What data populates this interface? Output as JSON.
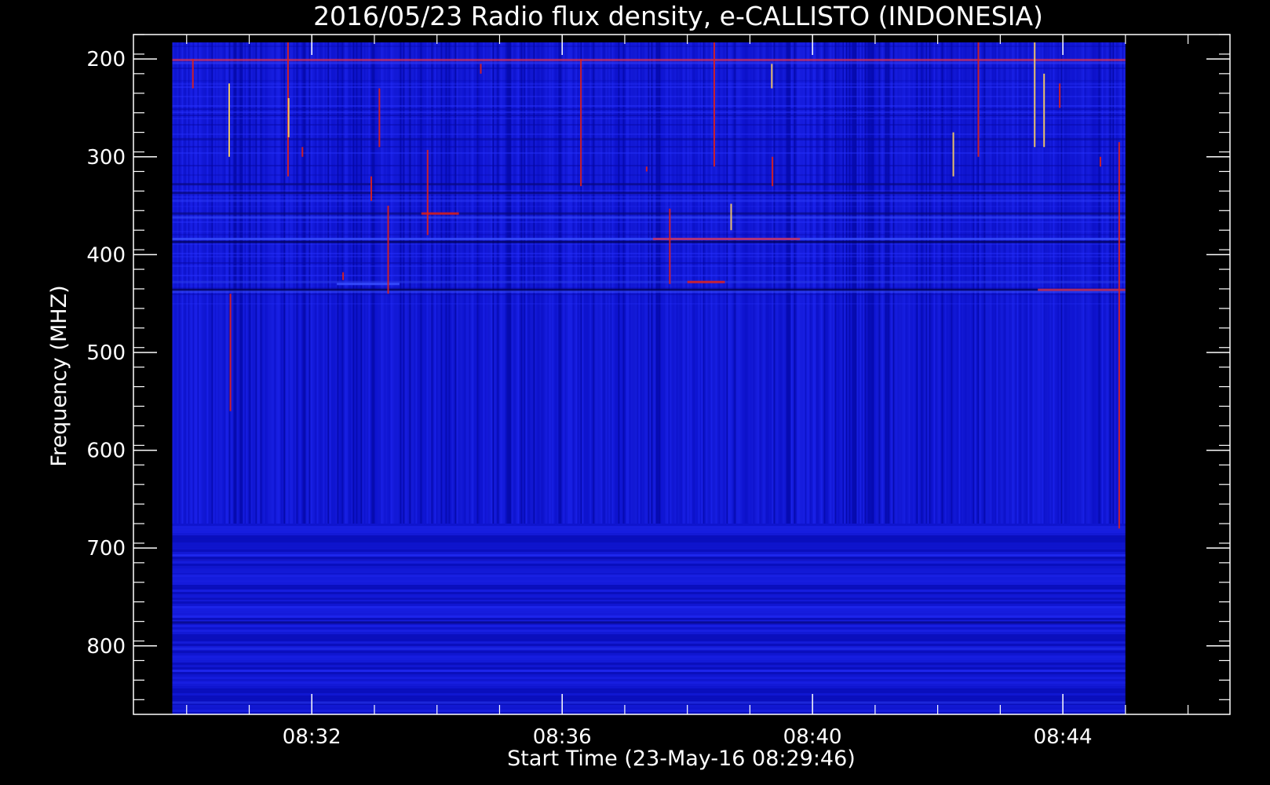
{
  "chart_data": {
    "type": "heatmap",
    "title": "2016/05/23  Radio flux density, e-CALLISTO (INDONESIA)",
    "xlabel": "Start Time (23-May-16 08:29:46)",
    "ylabel": "Frequency (MHZ)",
    "x_start_minutes": 509.77,
    "x_end_minutes": 525.0,
    "xlim_minutes": [
      509.15,
      526.67
    ],
    "x_ticks": [
      {
        "label": "08:32",
        "value": 512
      },
      {
        "label": "08:36",
        "value": 516
      },
      {
        "label": "08:40",
        "value": 520
      },
      {
        "label": "08:44",
        "value": 524
      }
    ],
    "ylim": [
      870,
      175
    ],
    "y_extent": [
      183,
      870
    ],
    "y_ticks": [
      200,
      300,
      400,
      500,
      600,
      700,
      800
    ],
    "colors": {
      "background": "#000000",
      "axis": "#ffffff",
      "low": "#0a0fc0",
      "mid": "#1d25ee",
      "high": "#e0201a",
      "peak": "#ffd060"
    },
    "horizontal_bands": [
      {
        "freq": 201,
        "color": "#d8305a",
        "opacity": 0.7
      },
      {
        "freq": 204,
        "color": "#3a44ff",
        "opacity": 0.5
      },
      {
        "freq": 282,
        "color": "#050590",
        "opacity": 0.5
      },
      {
        "freq": 328,
        "color": "#08087a",
        "opacity": 0.6
      },
      {
        "freq": 337,
        "color": "#060670",
        "opacity": 0.7
      },
      {
        "freq": 345,
        "color": "#3040ff",
        "opacity": 0.45
      },
      {
        "freq": 358,
        "color": "#060670",
        "opacity": 0.6
      },
      {
        "freq": 362,
        "color": "#3a50ff",
        "opacity": 0.55
      },
      {
        "freq": 384,
        "color": "#3a50ff",
        "opacity": 0.8
      },
      {
        "freq": 387,
        "color": "#040460",
        "opacity": 0.8
      },
      {
        "freq": 428,
        "color": "#3a50ff",
        "opacity": 0.4
      },
      {
        "freq": 436,
        "color": "#04045a",
        "opacity": 0.8
      },
      {
        "freq": 438,
        "color": "#3a50ff",
        "opacity": 0.5
      },
      {
        "freq": 712,
        "color": "#05059a",
        "opacity": 0.4
      },
      {
        "freq": 728,
        "color": "#2a35ff",
        "opacity": 0.3
      },
      {
        "freq": 752,
        "color": "#05059a",
        "opacity": 0.4
      },
      {
        "freq": 776,
        "color": "#04046a",
        "opacity": 0.6
      },
      {
        "freq": 803,
        "color": "#3040ff",
        "opacity": 0.35
      },
      {
        "freq": 858,
        "color": "#3545ff",
        "opacity": 0.45
      }
    ],
    "bursts": [
      {
        "time": 510.1,
        "f1": 200,
        "f2": 230,
        "color": "#e0201a"
      },
      {
        "time": 510.68,
        "f1": 225,
        "f2": 300,
        "color": "#ffd060"
      },
      {
        "time": 510.7,
        "f1": 440,
        "f2": 560,
        "color": "#e0201a"
      },
      {
        "time": 511.62,
        "f1": 183,
        "f2": 320,
        "color": "#e0201a"
      },
      {
        "time": 511.63,
        "f1": 240,
        "f2": 280,
        "color": "#ffd060"
      },
      {
        "time": 511.85,
        "f1": 290,
        "f2": 300,
        "color": "#e0201a"
      },
      {
        "time": 512.5,
        "f1": 418,
        "f2": 426,
        "color": "#e0201a"
      },
      {
        "time": 512.95,
        "f1": 320,
        "f2": 345,
        "color": "#e0201a"
      },
      {
        "time": 513.08,
        "f1": 230,
        "f2": 290,
        "color": "#e0201a"
      },
      {
        "time": 513.22,
        "f1": 350,
        "f2": 440,
        "color": "#e0201a"
      },
      {
        "time": 513.85,
        "f1": 293,
        "f2": 380,
        "color": "#e0201a"
      },
      {
        "time": 514.7,
        "f1": 205,
        "f2": 215,
        "color": "#e0201a"
      },
      {
        "time": 516.3,
        "f1": 200,
        "f2": 330,
        "color": "#e0201a"
      },
      {
        "time": 517.35,
        "f1": 310,
        "f2": 315,
        "color": "#e0201a"
      },
      {
        "time": 517.72,
        "f1": 353,
        "f2": 430,
        "color": "#e0201a"
      },
      {
        "time": 518.43,
        "f1": 183,
        "f2": 310,
        "color": "#e0201a"
      },
      {
        "time": 518.7,
        "f1": 348,
        "f2": 375,
        "color": "#ffd060"
      },
      {
        "time": 519.35,
        "f1": 205,
        "f2": 230,
        "color": "#ffd060"
      },
      {
        "time": 519.36,
        "f1": 300,
        "f2": 330,
        "color": "#e0201a"
      },
      {
        "time": 522.25,
        "f1": 275,
        "f2": 320,
        "color": "#ffd060"
      },
      {
        "time": 522.65,
        "f1": 183,
        "f2": 300,
        "color": "#e0201a"
      },
      {
        "time": 523.55,
        "f1": 183,
        "f2": 290,
        "color": "#ffd060"
      },
      {
        "time": 523.7,
        "f1": 215,
        "f2": 290,
        "color": "#ffd060"
      },
      {
        "time": 523.95,
        "f1": 225,
        "f2": 250,
        "color": "#e0201a"
      },
      {
        "time": 524.6,
        "f1": 300,
        "f2": 310,
        "color": "#e0201a"
      },
      {
        "time": 524.9,
        "f1": 285,
        "f2": 680,
        "color": "#e0201a"
      }
    ],
    "horizontal_segments": [
      {
        "t1": 513.75,
        "t2": 514.35,
        "freq": 358,
        "color": "#e0201a"
      },
      {
        "t1": 517.45,
        "t2": 519.8,
        "freq": 384,
        "color": "#c83060"
      },
      {
        "t1": 523.6,
        "t2": 525.0,
        "freq": 436,
        "color": "#c83060"
      },
      {
        "t1": 512.4,
        "t2": 513.4,
        "freq": 430,
        "color": "#3a50ff"
      },
      {
        "t1": 518.0,
        "t2": 518.6,
        "freq": 428,
        "color": "#e0201a"
      }
    ]
  }
}
